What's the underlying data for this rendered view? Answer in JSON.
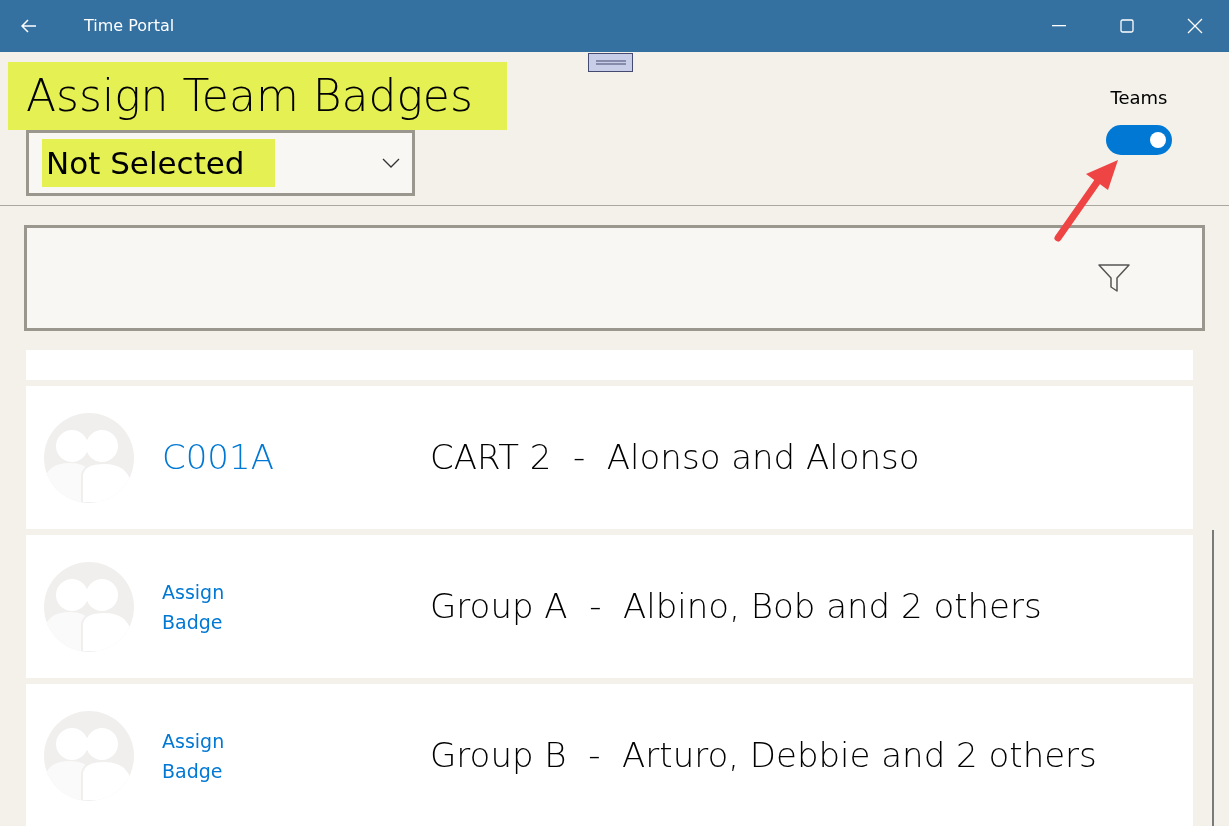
{
  "window": {
    "title": "Time Portal"
  },
  "header": {
    "title": "Assign Team Badges",
    "title_highlighted": true,
    "dropdown": {
      "value": "Not Selected",
      "highlighted": true
    },
    "toggle": {
      "label": "Teams",
      "on": true
    }
  },
  "rows": [
    {
      "kind": "code",
      "badge": "C001A",
      "description": "CART 2  -  Alonso and Alonso"
    },
    {
      "kind": "link",
      "badge": "Assign Badge",
      "description": "Group A  -  Albino, Bob and 2 others"
    },
    {
      "kind": "link",
      "badge": "Assign Badge",
      "description": "Group B  -  Arturo, Debbie and 2 others"
    }
  ]
}
